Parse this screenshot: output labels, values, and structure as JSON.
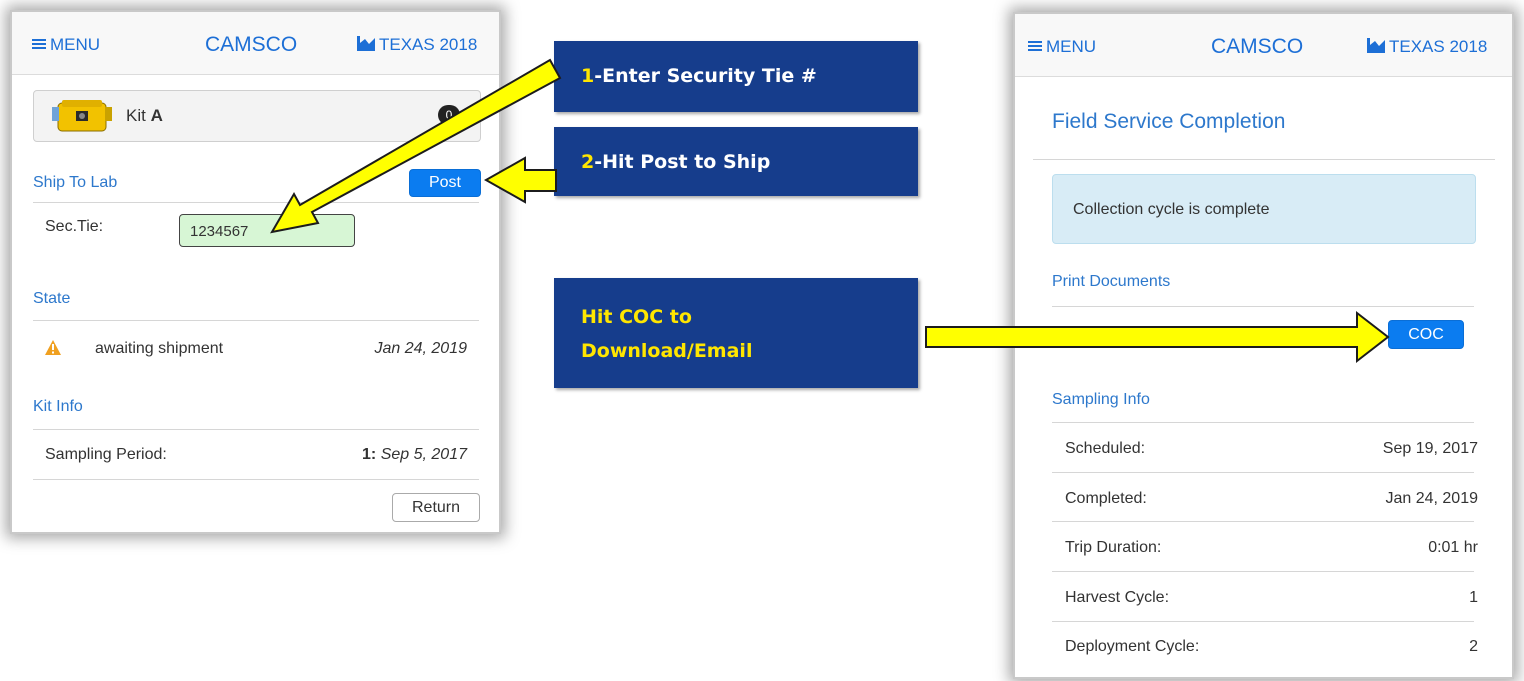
{
  "left_phone": {
    "nav": {
      "menu_label": "MENU",
      "brand": "CAMSCO",
      "state_label": "TEXAS 2018"
    },
    "kit": {
      "prefix": "Kit ",
      "name": "A",
      "badge_count": "0"
    },
    "ship_section": {
      "title": "Ship To Lab",
      "post_label": "Post"
    },
    "sec_tie": {
      "label": "Sec.Tie:",
      "value": "1234567"
    },
    "state_section": {
      "title": "State",
      "status": "awaiting shipment",
      "date": "Jan 24, 2019"
    },
    "kit_info": {
      "title": "Kit Info",
      "sampling_label": "Sampling Period:",
      "sampling_number": "1:",
      "sampling_date": "Sep 5, 2017"
    },
    "return_label": "Return"
  },
  "callouts": {
    "step1_num": "1",
    "step1_text": "-Enter Security Tie #",
    "step2_num": "2",
    "step2_text": "-Hit Post to Ship",
    "step3_line1": "Hit COC to",
    "step3_line2": "Download/Email"
  },
  "right_phone": {
    "nav": {
      "menu_label": "MENU",
      "brand": "CAMSCO",
      "state_label": "TEXAS 2018"
    },
    "page_title": "Field Service Completion",
    "alert": "Collection cycle is complete",
    "print_title": "Print Documents",
    "coc_label": "COC",
    "sampling_title": "Sampling Info",
    "rows": [
      {
        "label": "Scheduled:",
        "value": "Sep 19, 2017"
      },
      {
        "label": "Completed:",
        "value": "Jan 24, 2019"
      },
      {
        "label": "Trip Duration:",
        "value": "0:01 hr"
      },
      {
        "label": "Harvest Cycle:",
        "value": "1"
      },
      {
        "label": "Deployment Cycle:",
        "value": "2"
      }
    ]
  },
  "colors": {
    "link_blue": "#2d78cc",
    "primary_button": "#0b7cf0",
    "callout_bg": "#163d8c",
    "callout_highlight": "#ffe600",
    "arrow_fill": "#ffff00",
    "input_bg": "#d7f6d5",
    "alert_bg": "#d8ecf6"
  },
  "icons": {
    "menu": "hamburger-icon",
    "state": "bar-chart-icon",
    "warning": "warning-triangle-icon",
    "kit": "kit-case-image"
  }
}
